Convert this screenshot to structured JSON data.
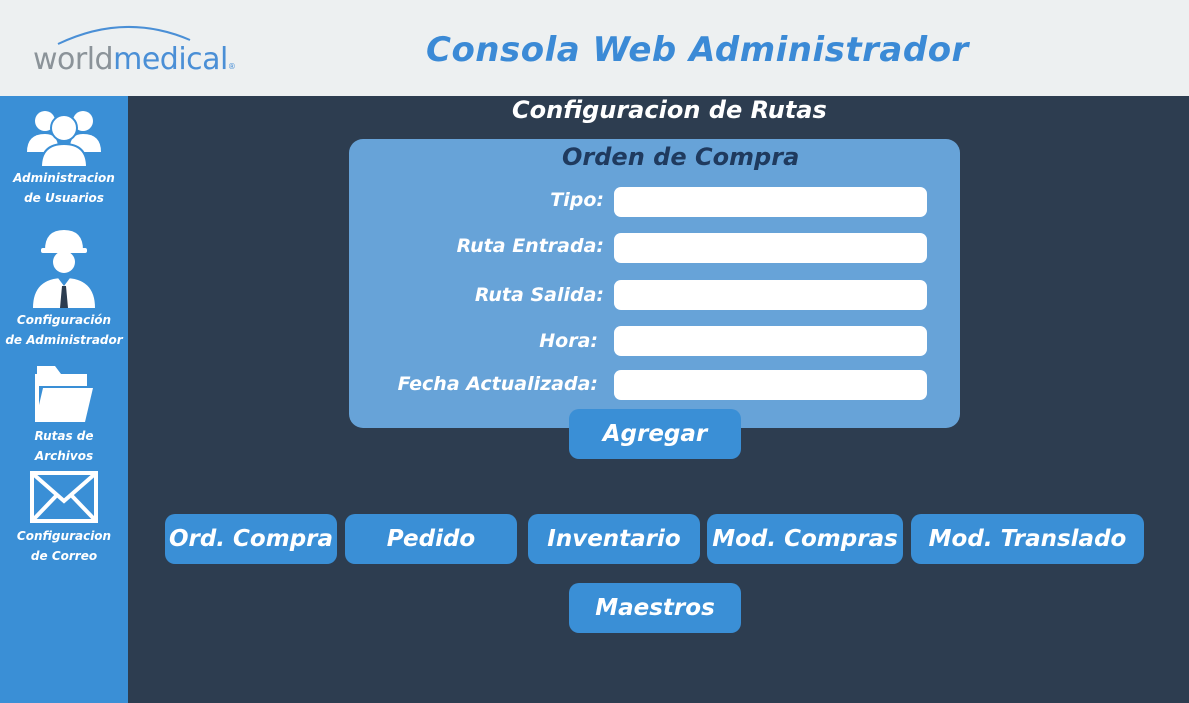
{
  "header": {
    "logo_world": "world",
    "logo_medical": "medical",
    "logo_reg": "®",
    "title": "Consola Web Administrador"
  },
  "sidebar": {
    "items": [
      {
        "icon": "users-icon",
        "label_line1": "Administracion",
        "label_line2": "de Usuarios"
      },
      {
        "icon": "admin-worker-icon",
        "label_line1": "Configuración",
        "label_line2": "de Administrador"
      },
      {
        "icon": "folder-icon",
        "label_line1": "Rutas de",
        "label_line2": "Archivos"
      },
      {
        "icon": "mail-icon",
        "label_line1": "Configuracion",
        "label_line2": "de Correo"
      }
    ]
  },
  "main": {
    "section_title": "Configuracion de Rutas",
    "form": {
      "title": "Orden de Compra",
      "fields": [
        {
          "label": "Tipo:",
          "value": ""
        },
        {
          "label": "Ruta Entrada:",
          "value": ""
        },
        {
          "label": "Ruta Salida:",
          "value": ""
        },
        {
          "label": "Hora:",
          "value": ""
        },
        {
          "label": "Fecha Actualizada:",
          "value": ""
        }
      ]
    },
    "add_button": "Agregar",
    "category_buttons": [
      "Ord. Compra",
      "Pedido",
      "Inventario",
      "Mod. Compras",
      "Mod. Translado"
    ],
    "maestros_button": "Maestros"
  },
  "colors": {
    "header_bg": "#edf0f1",
    "sidebar_bg": "#3a8fd6",
    "main_bg": "#2d3d50",
    "card_bg": "#67a3d8",
    "accent": "#3b8ad6",
    "form_title": "#1f3a5e"
  }
}
